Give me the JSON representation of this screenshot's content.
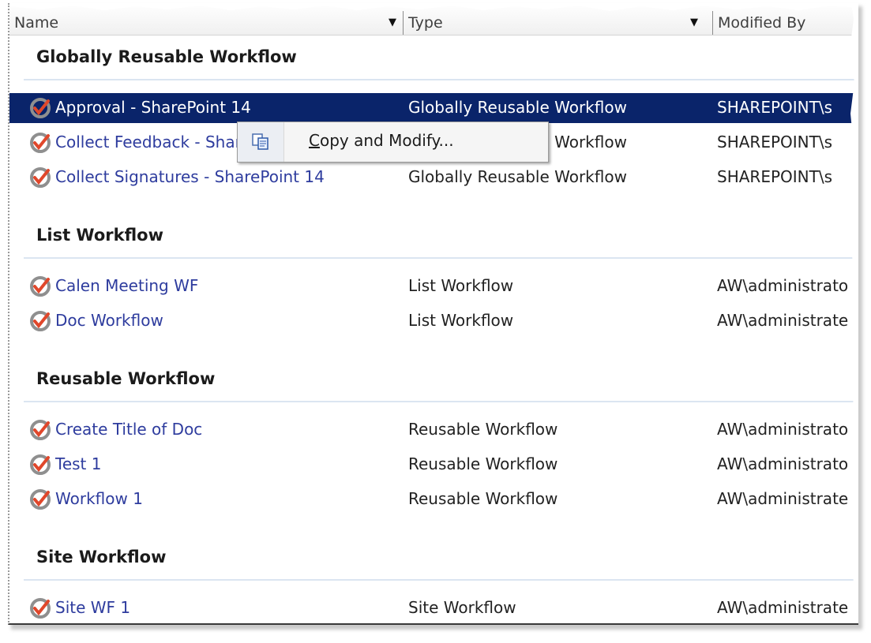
{
  "header": {
    "columns": [
      {
        "label": "Name"
      },
      {
        "label": "Type"
      },
      {
        "label": "Modified By"
      }
    ]
  },
  "groups": [
    {
      "title": "Globally Reusable Workflow",
      "rows": [
        {
          "name": "Approval - SharePoint 14",
          "type": "Globally Reusable Workflow",
          "modified_by": "SHAREPOINT\\s",
          "selected": true
        },
        {
          "name": "Collect Feedback - SharePoint 14",
          "type": "Globally Reusable Workflow",
          "modified_by": "SHAREPOINT\\s"
        },
        {
          "name": "Collect Signatures - SharePoint 14",
          "type": "Globally Reusable Workflow",
          "modified_by": "SHAREPOINT\\s"
        }
      ]
    },
    {
      "title": "List Workflow",
      "rows": [
        {
          "name": "Calen Meeting WF",
          "type": "List Workflow",
          "modified_by": "AW\\administrato"
        },
        {
          "name": "Doc Workflow",
          "type": "List Workflow",
          "modified_by": "AW\\administrate"
        }
      ]
    },
    {
      "title": "Reusable Workflow",
      "rows": [
        {
          "name": "Create Title of Doc",
          "type": "Reusable Workflow",
          "modified_by": "AW\\administrato"
        },
        {
          "name": "Test 1",
          "type": "Reusable Workflow",
          "modified_by": "AW\\administrato"
        },
        {
          "name": "Workflow 1",
          "type": "Reusable Workflow",
          "modified_by": "AW\\administrate"
        }
      ]
    },
    {
      "title": "Site Workflow",
      "rows": [
        {
          "name": "Site WF 1",
          "type": "Site Workflow",
          "modified_by": "AW\\administrate"
        }
      ]
    }
  ],
  "context_menu": {
    "item": {
      "accelerator": "C",
      "rest": "opy and Modify...",
      "icon": "copy-icon"
    }
  },
  "colors": {
    "selected_row": "#0a246a",
    "link_text": "#2e3c9e",
    "icon_check": "#e0472b"
  }
}
